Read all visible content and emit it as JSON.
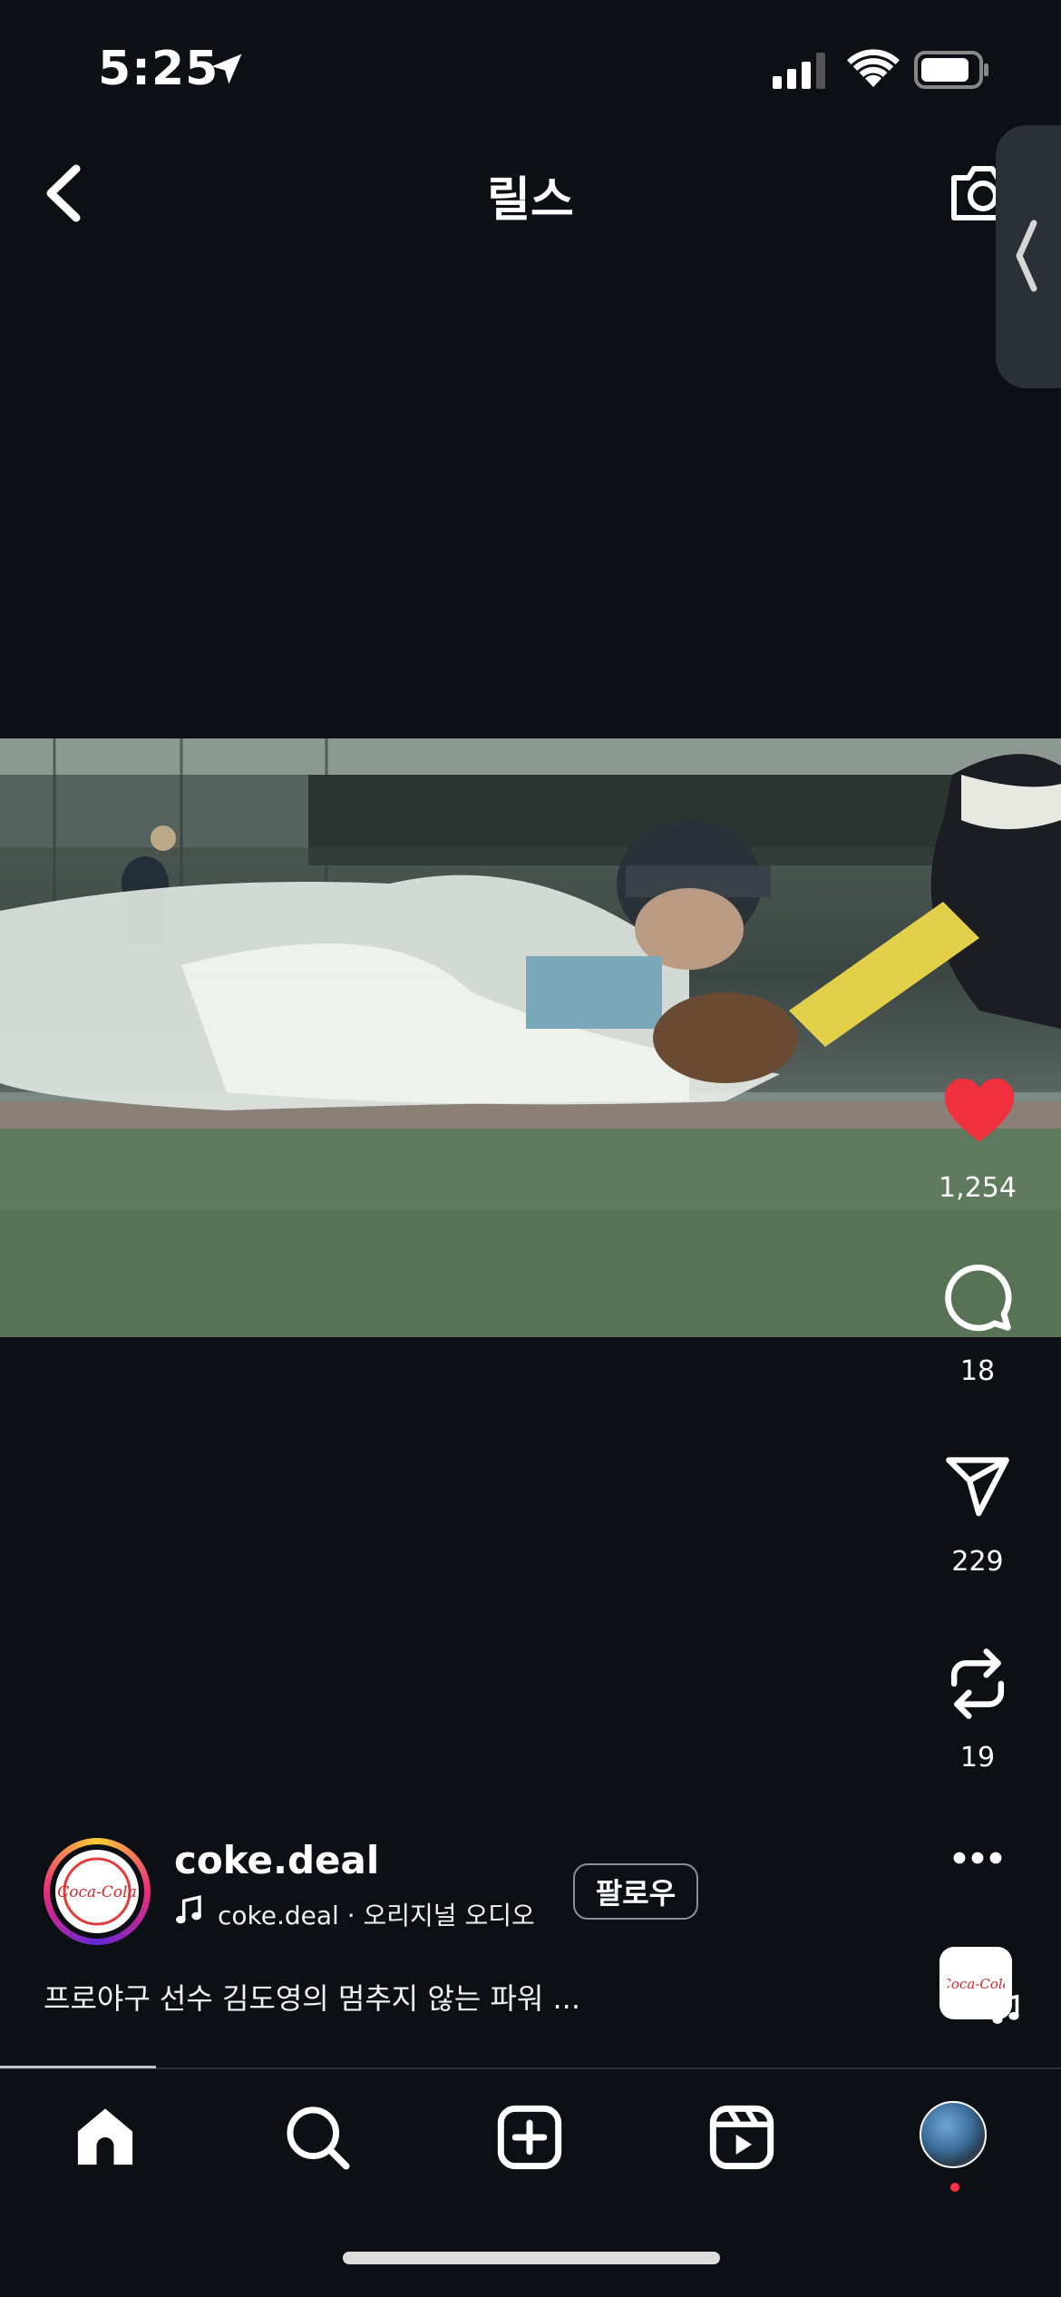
{
  "status_bar": {
    "time": "5:25"
  },
  "header": {
    "title": "릴스"
  },
  "actions": {
    "likes": "1,254",
    "comments": "18",
    "shares": "229",
    "remixes": "19"
  },
  "post": {
    "username": "coke.deal",
    "audio_user": "coke.deal",
    "audio_label": "오리지널 오디오",
    "follow_label": "팔로우",
    "caption": "프로야구 선수 김도영의 멈추지 않는 파워 ..."
  },
  "avatar_brand_text": "Coca-Cola",
  "colors": {
    "like": "#f0303c",
    "background": "#0c1015"
  },
  "icons": [
    "back-icon",
    "camera-icon",
    "heart-icon",
    "comment-icon",
    "send-icon",
    "remix-icon",
    "more-icon",
    "home-icon",
    "search-icon",
    "create-icon",
    "reels-icon"
  ]
}
